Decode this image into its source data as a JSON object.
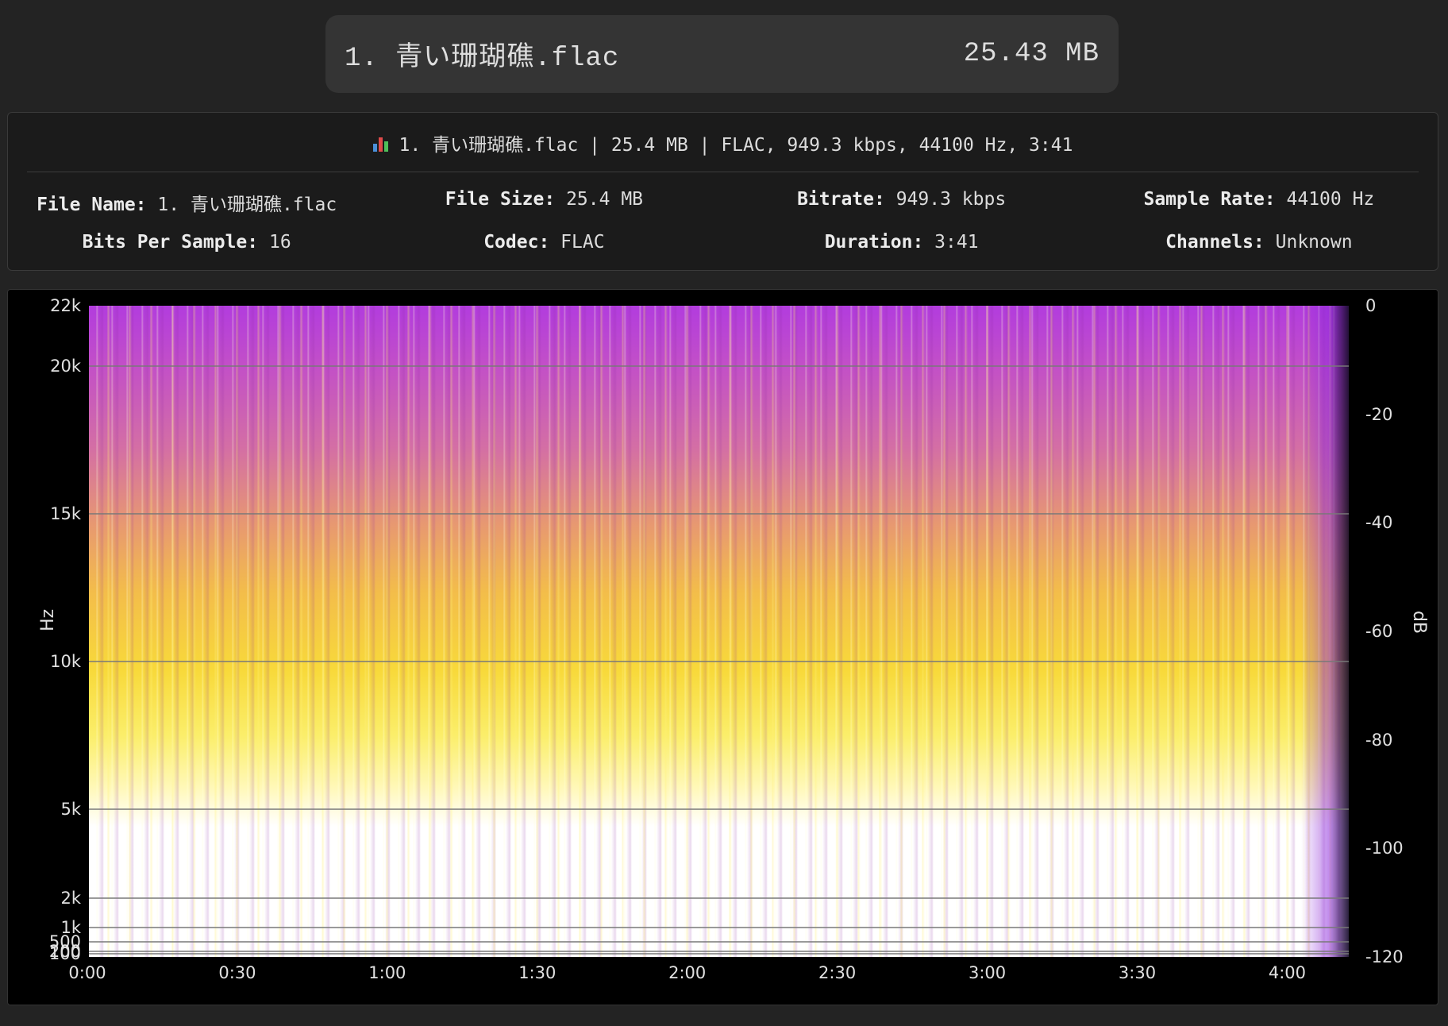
{
  "file_pill": {
    "name": "1. 青い珊瑚礁.flac",
    "size": "25.43 MB"
  },
  "info": {
    "summary": "1. 青い珊瑚礁.flac | 25.4 MB | FLAC, 949.3 kbps, 44100 Hz, 3:41",
    "summary_icon": "bar-chart-icon",
    "fields": [
      {
        "label": "File Name:",
        "value": "1. 青い珊瑚礁.flac"
      },
      {
        "label": "File Size:",
        "value": "25.4 MB"
      },
      {
        "label": "Bitrate:",
        "value": "949.3 kbps"
      },
      {
        "label": "Sample Rate:",
        "value": "44100 Hz"
      },
      {
        "label": "Bits Per Sample:",
        "value": "16"
      },
      {
        "label": "Codec:",
        "value": "FLAC"
      },
      {
        "label": "Duration:",
        "value": "3:41"
      },
      {
        "label": "Channels:",
        "value": "Unknown"
      }
    ]
  },
  "chart_data": {
    "type": "heatmap",
    "title": "",
    "ylabel": "Hz",
    "colorbar_label": "dB",
    "y_ticks": [
      {
        "label": "22k",
        "value": 22050
      },
      {
        "label": "20k",
        "value": 20000
      },
      {
        "label": "15k",
        "value": 15000
      },
      {
        "label": "10k",
        "value": 10000
      },
      {
        "label": "5k",
        "value": 5000
      },
      {
        "label": "2k",
        "value": 2000
      },
      {
        "label": "1k",
        "value": 1000
      },
      {
        "label": "500",
        "value": 500
      },
      {
        "label": "200",
        "value": 200
      },
      {
        "label": "100",
        "value": 100
      }
    ],
    "x_ticks": [
      "0:00",
      "0:30",
      "1:00",
      "1:30",
      "2:00",
      "2:30",
      "3:00",
      "3:30",
      "4:00"
    ],
    "x_range_seconds": [
      0,
      252
    ],
    "db_ticks": [
      "0",
      "-20",
      "-40",
      "-60",
      "-80",
      "-100",
      "-120"
    ],
    "db_range": [
      -120,
      0
    ],
    "colormap": [
      "#000000",
      "#3a0a6e",
      "#a32cc4",
      "#e0557a",
      "#f5a623",
      "#fff35c",
      "#ffffff"
    ],
    "grid": true
  }
}
